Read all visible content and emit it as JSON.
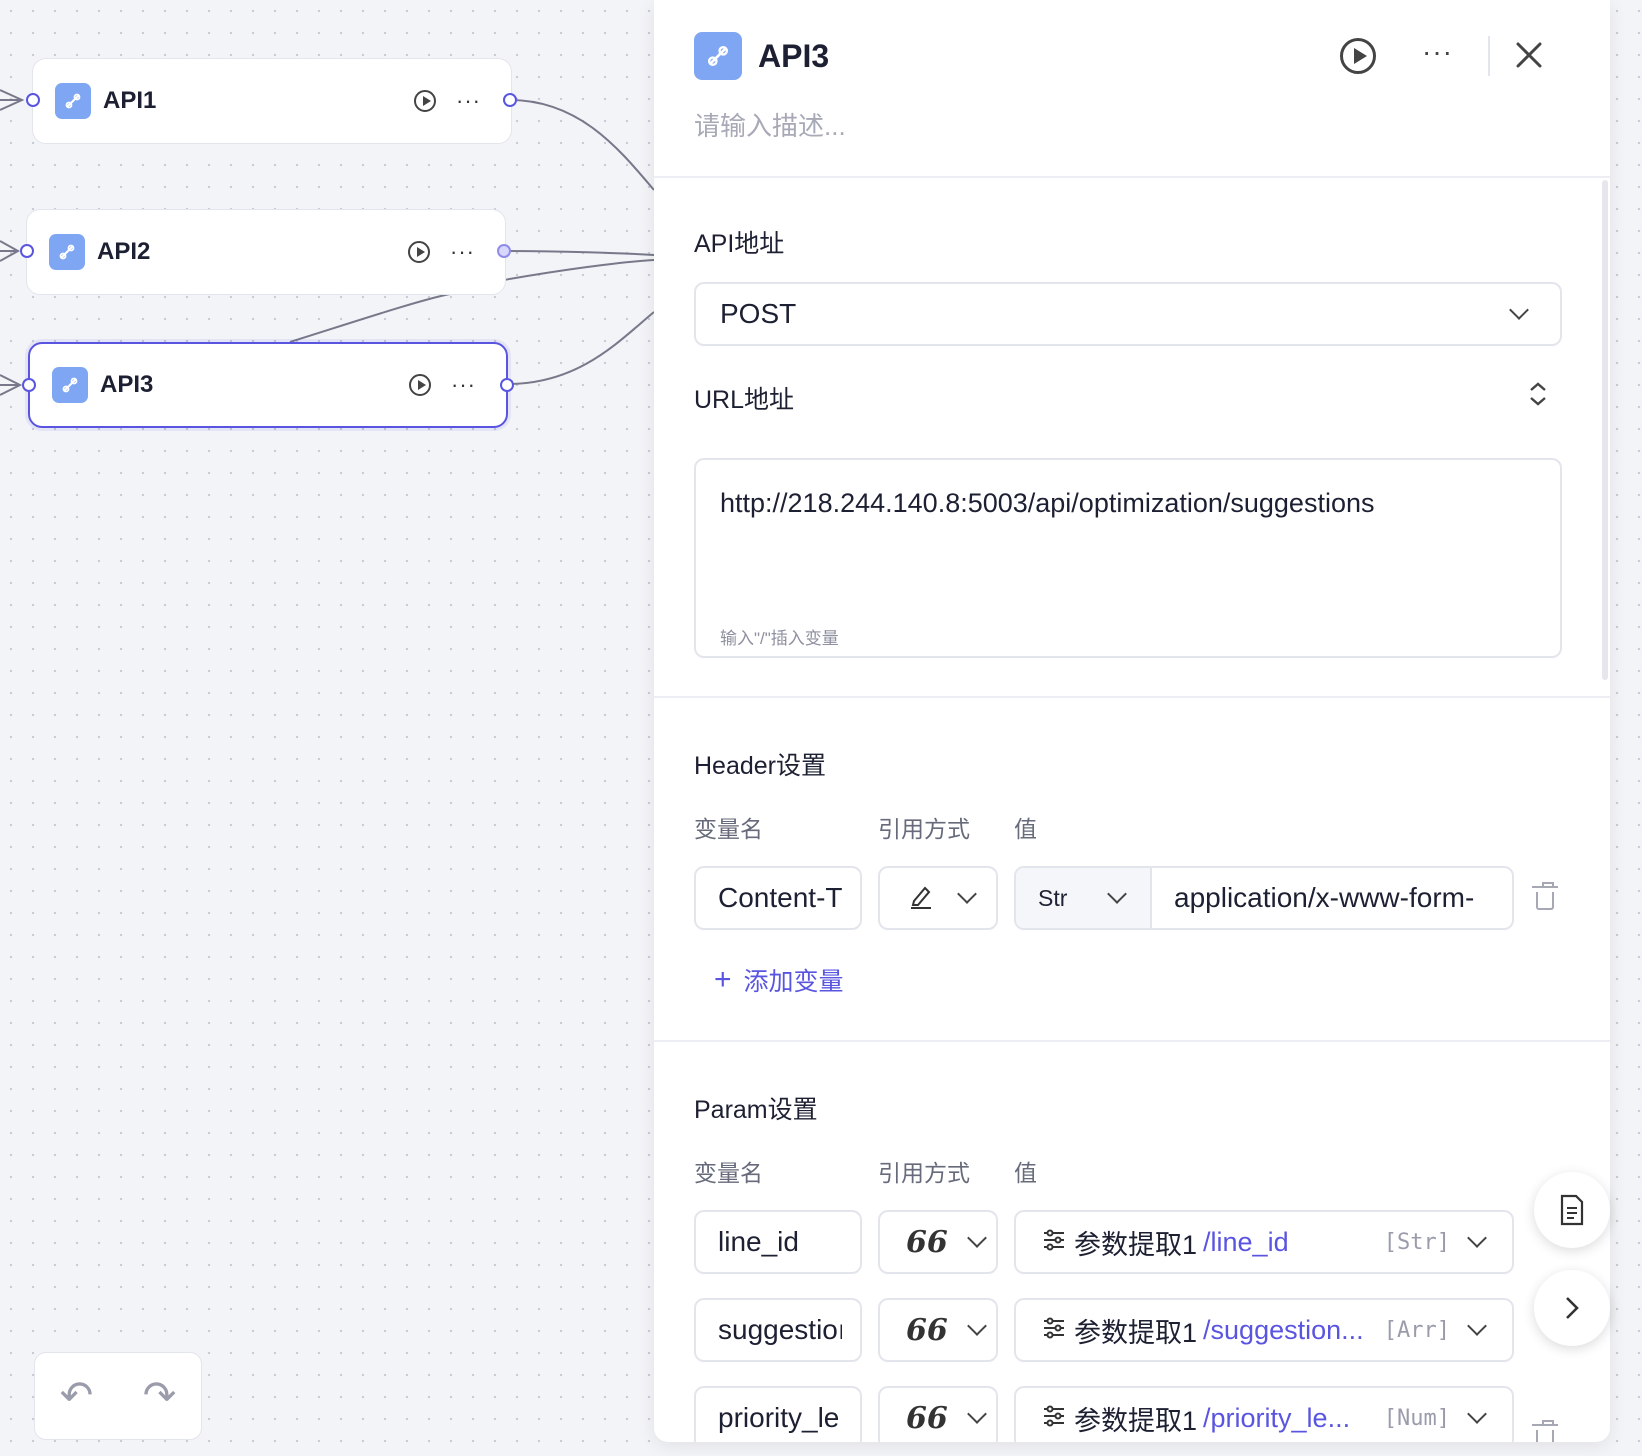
{
  "canvas": {
    "nodes": [
      {
        "title": "API1"
      },
      {
        "title": "API2"
      },
      {
        "title": "API3"
      }
    ],
    "toolbar": {
      "undo_icon": "undo-icon",
      "redo_icon": "redo-icon"
    }
  },
  "panel": {
    "title": "API3",
    "description_placeholder": "请输入描述...",
    "api_section": {
      "title": "API地址",
      "method": "POST",
      "url_label": "URL地址",
      "url_value": "http://218.244.140.8:5003/api/optimization/suggestions",
      "url_hint": "输入\"/\"插入变量"
    },
    "header_section": {
      "title": "Header设置",
      "columns": {
        "name": "变量名",
        "ref": "引用方式",
        "value": "值"
      },
      "rows": [
        {
          "name": "Content-T",
          "type": "Str",
          "value": "application/x-www-form-"
        }
      ],
      "add_label": "添加变量"
    },
    "param_section": {
      "title": "Param设置",
      "columns": {
        "name": "变量名",
        "ref": "引用方式",
        "value": "值"
      },
      "rows": [
        {
          "name": "line_id",
          "source": "参数提取1",
          "path": "/line_id",
          "type": "[Str]"
        },
        {
          "name": "suggestioı",
          "source": "参数提取1",
          "path": "/suggestion...",
          "type": "[Arr]"
        },
        {
          "name": "priority_le",
          "source": "参数提取1",
          "path": "/priority_le...",
          "type": "[Num]"
        }
      ]
    }
  }
}
